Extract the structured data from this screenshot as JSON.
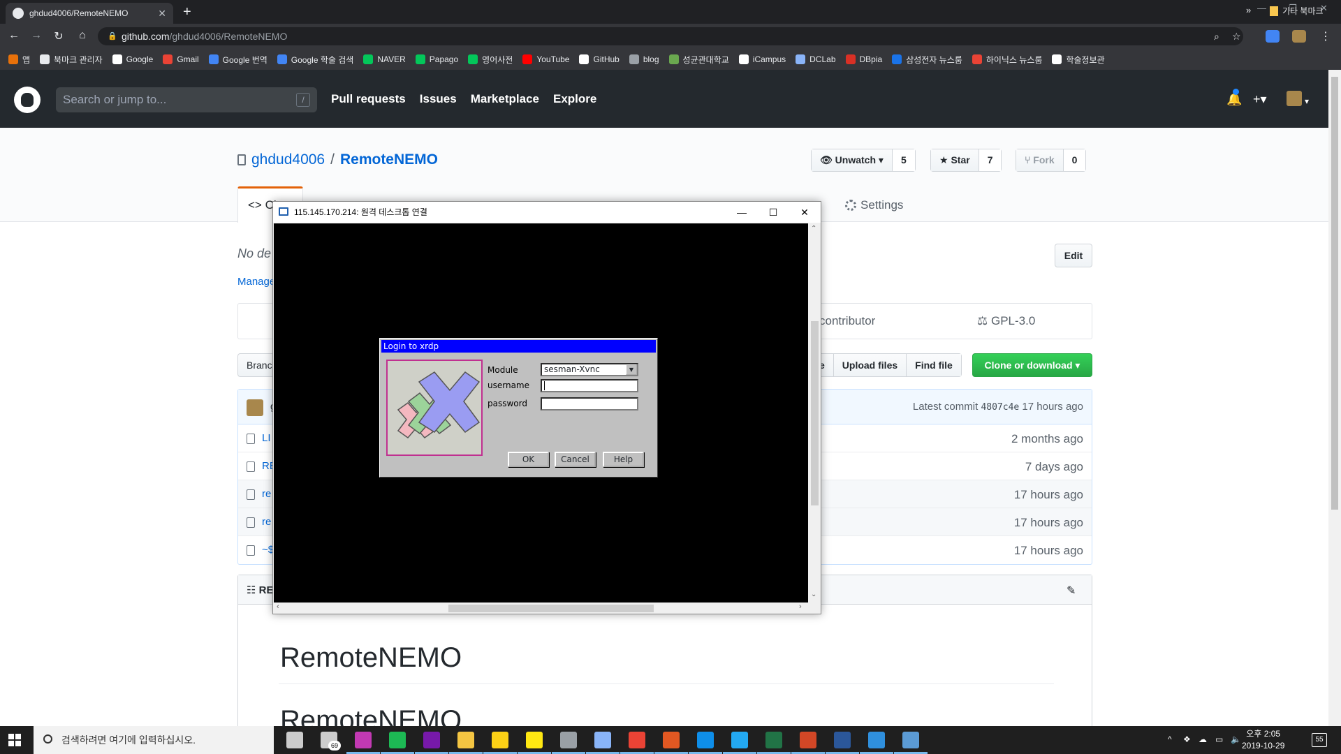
{
  "browser": {
    "tab_title": "ghdud4006/RemoteNEMO",
    "tab_close": "✕",
    "new_tab": "+",
    "url_host": "github.com",
    "url_path": "/ghdud4006/RemoteNEMO",
    "bookmarks": [
      {
        "label": "앱",
        "color": "#e8710a"
      },
      {
        "label": "북마크 관리자",
        "color": "#e8eaed"
      },
      {
        "label": "Google",
        "color": "#ffffff"
      },
      {
        "label": "Gmail",
        "color": "#ea4335"
      },
      {
        "label": "Google 번역",
        "color": "#4285f4"
      },
      {
        "label": "Google 학술 검색",
        "color": "#4285f4"
      },
      {
        "label": "NAVER",
        "color": "#03c75a"
      },
      {
        "label": "Papago",
        "color": "#03c75a"
      },
      {
        "label": "영어사전",
        "color": "#03c75a"
      },
      {
        "label": "YouTube",
        "color": "#ff0000"
      },
      {
        "label": "GitHub",
        "color": "#ffffff"
      },
      {
        "label": "blog",
        "color": "#9aa0a6"
      },
      {
        "label": "성균관대학교",
        "color": "#6aa84f"
      },
      {
        "label": "iCampus",
        "color": "#ffffff"
      },
      {
        "label": "DCLab",
        "color": "#8ab4f8"
      },
      {
        "label": "DBpia",
        "color": "#d93025"
      },
      {
        "label": "삼성전자 뉴스룸",
        "color": "#1a73e8"
      },
      {
        "label": "하이닉스 뉴스룸",
        "color": "#ea4335"
      },
      {
        "label": "학술정보관",
        "color": "#ffffff"
      }
    ],
    "bookmarks_more": "»",
    "other_bookmarks": "기타 북마크"
  },
  "github": {
    "search_placeholder": "Search or jump to...",
    "search_key": "/",
    "nav": [
      "Pull requests",
      "Issues",
      "Marketplace",
      "Explore"
    ],
    "owner": "ghdud4006",
    "separator": "/",
    "repo": "RemoteNEMO",
    "watch_label": "Unwatch",
    "watch_count": "5",
    "star_label": "Star",
    "star_count": "7",
    "fork_label": "Fork",
    "fork_count": "0",
    "code_tab": "<> Cl",
    "settings_tab": "Settings",
    "description": "No de",
    "manage": "Manage",
    "edit": "Edit",
    "contributor": "contributor",
    "license": "GPL-3.0",
    "branch": "Branc",
    "file_buttons": [
      "e",
      "Upload files",
      "Find file"
    ],
    "clone": "Clone or download ▾",
    "latest_commit_label": "Latest commit",
    "latest_commit_sha": "4807c4e",
    "latest_commit_age": "17 hours ago",
    "commit_author": "g",
    "files": [
      {
        "name": "LI",
        "age": "2 months ago"
      },
      {
        "name": "RE",
        "age": "7 days ago"
      },
      {
        "name": "re",
        "age": "17 hours ago"
      },
      {
        "name": "re",
        "age": "17 hours ago"
      },
      {
        "name": "~$",
        "age": "17 hours ago"
      }
    ],
    "readme_tab": "RE",
    "readme_h1": "RemoteNEMO",
    "readme_h1b": "RemoteNEMO"
  },
  "rdp": {
    "title": "115.145.170.214: 원격 데스크톱 연결",
    "minimize": "—",
    "maximize": "☐",
    "close": "✕",
    "scroll_up": "⌃",
    "scroll_down": "⌄",
    "scroll_left": "‹",
    "scroll_right": "›"
  },
  "xrdp": {
    "title": "Login to xrdp",
    "module_label": "Module",
    "module_value": "sesman-Xvnc",
    "username_label": "username",
    "username_value": "",
    "password_label": "password",
    "password_value": "",
    "ok": "OK",
    "cancel": "Cancel",
    "help": "Help"
  },
  "taskbar": {
    "search_placeholder": "검색하려면 여기에 입력하십시오.",
    "mail_badge": "69",
    "time_ampm": "오후 2:05",
    "date": "2019-10-29",
    "notifications": "55",
    "apps": [
      {
        "name": "task-view",
        "color": "#cccccc"
      },
      {
        "name": "mail",
        "color": "#cccccc"
      },
      {
        "name": "app-m",
        "color": "#c239b3"
      },
      {
        "name": "app-green",
        "color": "#1db954"
      },
      {
        "name": "onenote",
        "color": "#7719aa"
      },
      {
        "name": "explorer",
        "color": "#f4c542"
      },
      {
        "name": "sticky",
        "color": "#fcd116"
      },
      {
        "name": "kakaotalk",
        "color": "#ffe812"
      },
      {
        "name": "app-paint",
        "color": "#9aa0a6"
      },
      {
        "name": "app-blue",
        "color": "#89b4f8"
      },
      {
        "name": "chrome",
        "color": "#ea4335"
      },
      {
        "name": "app-red",
        "color": "#e25822"
      },
      {
        "name": "teamviewer",
        "color": "#0e8ee9"
      },
      {
        "name": "vscode",
        "color": "#23a9f2"
      },
      {
        "name": "excel",
        "color": "#217346"
      },
      {
        "name": "powerpoint",
        "color": "#d24726"
      },
      {
        "name": "word",
        "color": "#2b579a"
      },
      {
        "name": "app-box",
        "color": "#2f8fdd"
      },
      {
        "name": "rdp",
        "color": "#5b9bd5"
      }
    ]
  }
}
